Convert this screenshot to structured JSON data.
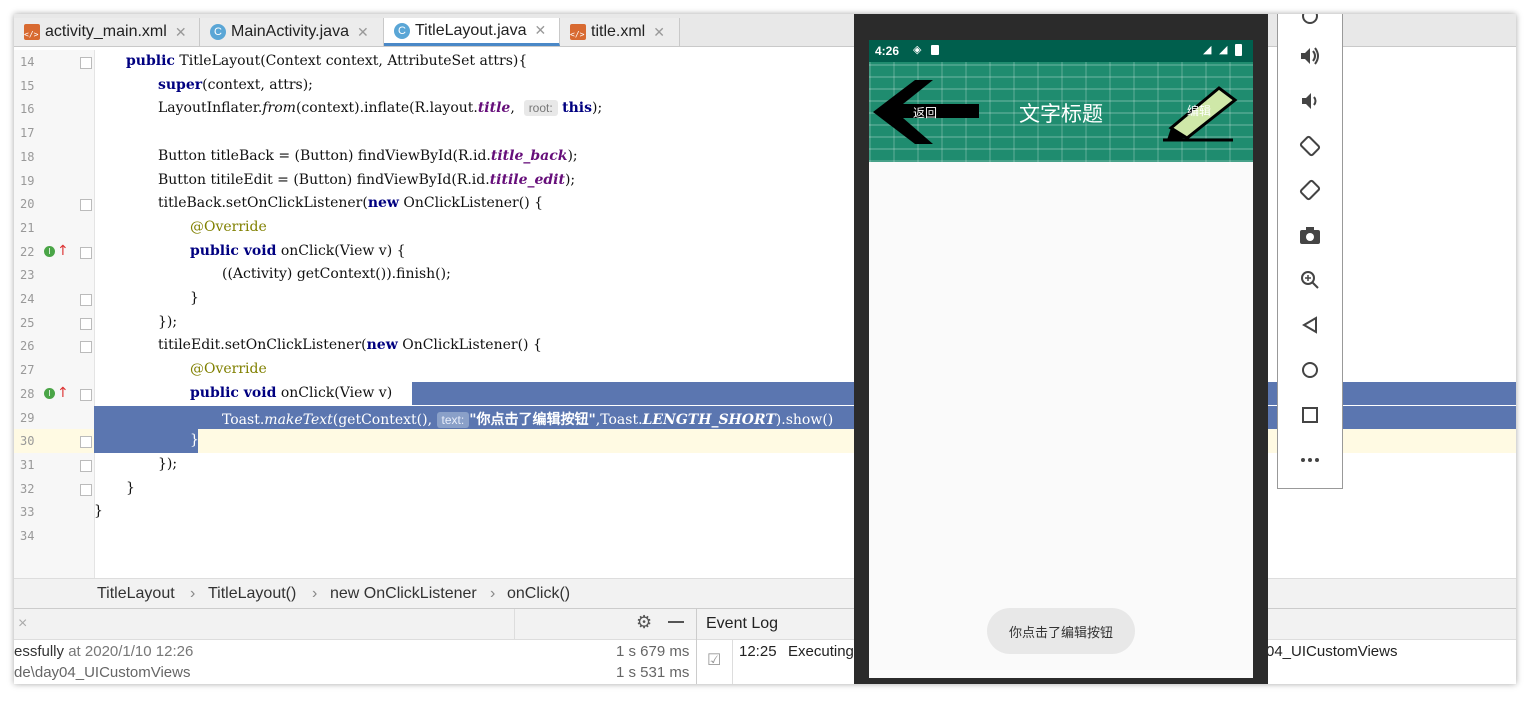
{
  "tabs": [
    {
      "label": "activity_main.xml",
      "type": "xml",
      "active": false
    },
    {
      "label": "MainActivity.java",
      "type": "class",
      "active": false
    },
    {
      "label": "TitleLayout.java",
      "type": "class",
      "active": true
    },
    {
      "label": "title.xml",
      "type": "xml",
      "active": false
    }
  ],
  "editor": {
    "line_numbers": [
      "14",
      "15",
      "16",
      "17",
      "18",
      "19",
      "20",
      "21",
      "22",
      "23",
      "24",
      "25",
      "26",
      "27",
      "28",
      "29",
      "30",
      "31",
      "32",
      "33",
      "34"
    ],
    "code": {
      "l14": {
        "kw": "public",
        "rest": " TitleLayout(Context context, AttributeSet attrs){"
      },
      "l15": {
        "kw": "super",
        "rest": "(context, attrs);"
      },
      "l16": {
        "a": "LayoutInflater.",
        "it": "from",
        "b": "(context).inflate(R.layout.",
        "fld": "title",
        "c": ",  ",
        "hint": "root:",
        "kw": "this",
        "d": ");"
      },
      "l18": {
        "a": "Button titleBack = (Button) findViewById(R.id.",
        "fld": "title_back",
        "d": ");"
      },
      "l19": {
        "a": "Button titileEdit = (Button) findViewById(R.id.",
        "fld": "titile_edit",
        "d": ");"
      },
      "l20": {
        "a": "titleBack.setOnClickListener(",
        "kw": "new",
        "d": " OnClickListener() {"
      },
      "l21": {
        "ann": "@Override"
      },
      "l22": {
        "kw": "public void",
        "d": " onClick(View v) {"
      },
      "l23": {
        "a": "((Activity) getContext()).finish();"
      },
      "l24": {
        "a": "}"
      },
      "l25": {
        "a": "});"
      },
      "l26": {
        "a": "titileEdit.setOnClickListener(",
        "kw": "new",
        "d": " OnClickListener() {"
      },
      "l27": {
        "ann": "@Override"
      },
      "l28": {
        "kw": "public void",
        "d": " onClick(View v) ",
        "e": "{"
      },
      "l29": {
        "a": "Toast.",
        "it": "makeText",
        "b": "(getContext(), ",
        "hint": "text:",
        "str": "\"你点击了编辑按钮\"",
        "c": ",Toast.",
        "fld": "LENGTH_SHORT",
        "d": ").show()"
      },
      "l30": {
        "a": "}"
      },
      "l31": {
        "a": "});"
      },
      "l32": {
        "a": "}"
      },
      "l33": {
        "a": "}"
      }
    }
  },
  "breadcrumb": [
    "TitleLayout",
    "TitleLayout()",
    "new OnClickListener",
    "onClick()"
  ],
  "build_panel": {
    "close": "×",
    "row1_text": "essfully",
    "row1_time": "at 2020/1/10 12:26",
    "row1_dur": "1 s 679 ms",
    "row2_text": "de\\day04_UICustomViews",
    "row2_dur": "1 s 531 ms"
  },
  "event_log": {
    "title": "Event Log",
    "time": "12:25",
    "msg": "Executing",
    "tail": "04_UICustomViews"
  },
  "phone": {
    "time": "4:26",
    "back_label": "返回",
    "title": "文字标题",
    "edit_label": "编辑",
    "toast": "你点击了编辑按钮"
  },
  "colors": {
    "titlebar": "#1f8c6f",
    "statusbar": "#005f4d",
    "selection": "#5b76b0",
    "caret_line": "#fffae3"
  },
  "emulator_controls": [
    "power-icon",
    "volume-up-icon",
    "volume-down-icon",
    "rotate-left-icon",
    "rotate-right-icon",
    "camera-icon",
    "zoom-icon",
    "back-icon",
    "home-icon",
    "overview-icon",
    "more-icon"
  ]
}
